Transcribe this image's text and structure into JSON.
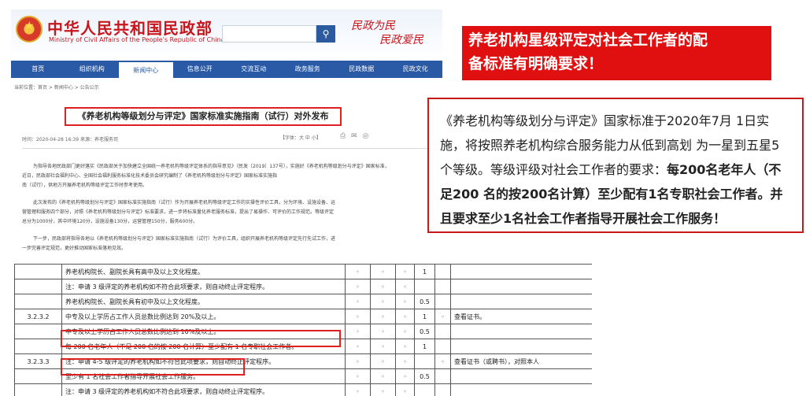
{
  "site": {
    "logo_cn": "中华人民共和国民政部",
    "logo_en": "Ministry of Civil Affairs of the People's Republic of China",
    "slogan_line1": "民政为民",
    "slogan_line2": "民政爱民",
    "search_icon": "search-icon",
    "nav": [
      "首页",
      "组织机构",
      "新闻中心",
      "信息公开",
      "交流互动",
      "政务服务",
      "民政数据",
      "民政文化"
    ],
    "nav_active_index": 2,
    "breadcrumb": "当前位置：首页 > 新闻中心 > 公告公示",
    "article_title": "《养老机构等级划分与评定》国家标准实施指南（试行）对外发布",
    "meta": "时间：2020-04-28 16:39   来源：养老服务司",
    "font_ctl": "【字体：大 中 小】",
    "para1_line1": "为指导各地民政部门更好落实《民政部关于加快建立全国统一养老机构等级评定体系的指导意见》（民发〔2019〕137号），实施好《养老机构等级划分与评定》国家标准，",
    "para1_line2": "近日，民政部社会福利中心、全国社会福利服务标准化技术委员会研究编制了《养老机构等级划分与评定》国家标准实施指",
    "para1_line3": "南（试行），供地方开展养老机构等级评定工作时参考使用。",
    "para2_line1": "此次发布的《养老机构等级划分与评定》国家标准实施指南（试行）作为开展养老机构等级评定工作的实操性评价工具，分为环境、设施设备、运",
    "para2_line2": "营管理和服务四个部分，对照《养老机构等级划分与评定》标准要求，进一步将标准量化养老服务标准，提出了易操作、可评价的工作规范。等级评定",
    "para2_line3": "总分为1000分，其中环境120分，设施设备130分，运营管理150分，服务600分。",
    "para3_line1": "下一步，民政部将指导各地以《养老机构等级划分与评定》国家标准实施指南（试行）为评价工具，组织开展养老机构等级评定先行先试工作，进",
    "para3_line2": "一步完善评定规范，更好推动国家标准落地见效。"
  },
  "headline": {
    "line1": "养老机构星级评定对社会工作者的配",
    "line2": "备标准有明确要求！"
  },
  "desc": {
    "normal1": "《养老机构等级划分与评定》国家标准于2020年7月 1日实施，将按照养老机构综合服务能力从低到高划 为一星到五星5个等级。等级评级对社会工作者的要求：",
    "bold1": "每200名老年人（不足200 名的按200名计算）至少配有1名专职社会工作者。并且要求至少1名社会工作者指导开展社会工作服务！"
  },
  "table": {
    "rows": [
      {
        "code": "",
        "text": "养老机构院长、副院长具有高中及以上文化程度。",
        "m1": "◦",
        "m2": "◦",
        "m3": "◦",
        "score": "1",
        "m4": "",
        "note": ""
      },
      {
        "code": "",
        "text": "注：申请 3 级评定的养老机构如不符合此项要求，则自动终止评定程序。",
        "m1": "◦",
        "m2": "◦",
        "m3": "◦",
        "score": "",
        "m4": "",
        "note": ""
      },
      {
        "code": "",
        "text": "养老机构院长、副院长具有初中及以上文化程度。",
        "m1": "◦",
        "m2": "◦",
        "m3": "◦",
        "score": "0.5",
        "m4": "",
        "note": ""
      },
      {
        "code": "3.2.3.2",
        "text": "中专及以上学历占工作人员总数比例达到 20%及以上。",
        "m1": "◦",
        "m2": "◦",
        "m3": "◦",
        "score": "1",
        "m4": "◦",
        "note": "查看证书。"
      },
      {
        "code": "",
        "text": "中专及以上学历占工作人员总数比例达到 10%及以上。",
        "m1": "◦",
        "m2": "◦",
        "m3": "◦",
        "score": "0.5",
        "m4": "",
        "note": ""
      },
      {
        "code": "",
        "text": "每 200 名老年人（不足 200 名的按 200 名计算）至少配有 1 名专职社会工作者。",
        "m1": "◦",
        "m2": "◦",
        "m3": "◦",
        "score": "1",
        "m4": "",
        "note": ""
      },
      {
        "code": "3.2.3.3",
        "text": "注：申请 4-5 级评定的养老机构如不符合此项要求，则自动终止评定程序。",
        "m1": "◦",
        "m2": "◦",
        "m3": "◦",
        "score": "",
        "m4": "◦",
        "note": "查看证书（或聘书），对照本人"
      },
      {
        "code": "",
        "text": "至少有 1 名社会工作者指导开展社会工作服务。",
        "m1": "◦",
        "m2": "◦",
        "m3": "◦",
        "score": "0.5",
        "m4": "",
        "note": ""
      },
      {
        "code": "",
        "text": "注：申请 3 级评定的养老机构如不符合此项要求，则自动终止评定程序。",
        "m1": "◦",
        "m2": "◦",
        "m3": "◦",
        "score": "",
        "m4": "",
        "note": ""
      }
    ]
  },
  "colors": {
    "accent_red": "#e01010",
    "nav_blue": "#2a5aa5"
  }
}
